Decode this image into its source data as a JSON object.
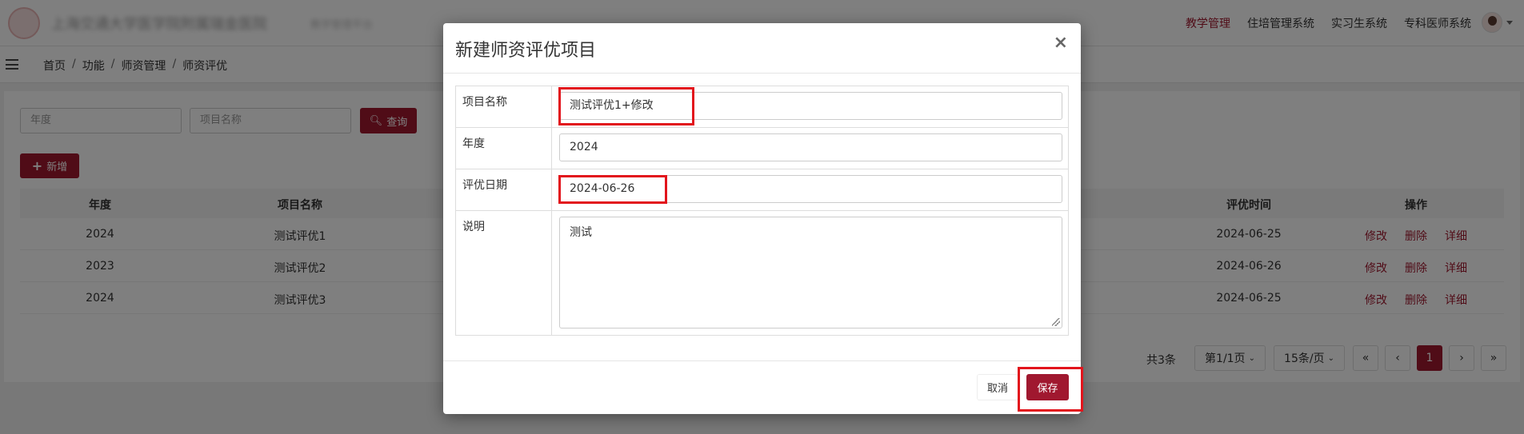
{
  "header": {
    "org_name": "上海交通大学医学院附属瑞金医院",
    "org_sub": "教学管理平台",
    "nav": [
      {
        "label": "教学管理",
        "active": true
      },
      {
        "label": "住培管理系统",
        "active": false
      },
      {
        "label": "实习生系统",
        "active": false
      },
      {
        "label": "专科医师系统",
        "active": false
      }
    ]
  },
  "breadcrumb": [
    "首页",
    "功能",
    "师资管理",
    "师资评优"
  ],
  "filters": {
    "year_placeholder": "年度",
    "name_placeholder": "项目名称",
    "query_label": "查询",
    "add_label": "新增"
  },
  "table": {
    "columns": [
      "年度",
      "项目名称",
      "评优时间",
      "操作"
    ],
    "rows": [
      {
        "year": "2024",
        "name": "测试评优1",
        "date": "2024-06-25"
      },
      {
        "year": "2023",
        "name": "测试评优2",
        "date": "2024-06-26"
      },
      {
        "year": "2024",
        "name": "测试评优3",
        "date": "2024-06-25"
      }
    ],
    "actions": {
      "edit": "修改",
      "delete": "删除",
      "detail": "详细"
    }
  },
  "pagination": {
    "total": "共3条",
    "page_select": "第1/1页",
    "size_select": "15条/页",
    "first": "«",
    "prev": "‹",
    "current": "1",
    "next": "›",
    "last": "»"
  },
  "modal": {
    "title": "新建师资评优项目",
    "close": "×",
    "fields": {
      "name_label": "项目名称",
      "name_value": "测试评优1+修改",
      "year_label": "年度",
      "year_value": "2024",
      "date_label": "评优日期",
      "date_value": "2024-06-26",
      "desc_label": "说明",
      "desc_value": "测试"
    },
    "cancel_label": "取消",
    "save_label": "保存"
  },
  "colors": {
    "accent": "#a0182f",
    "highlight": "#e2141c"
  }
}
